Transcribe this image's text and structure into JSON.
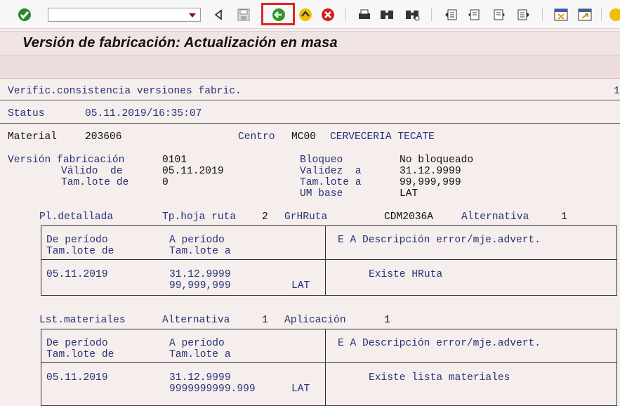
{
  "toolbar": {
    "command_value": "",
    "icons": [
      "enter-icon",
      "back-icon",
      "save-icon",
      "exit-icon",
      "home-icon",
      "cancel-icon",
      "print-icon",
      "find-icon",
      "find-next-icon",
      "first-page-icon",
      "prev-page-icon",
      "next-page-icon",
      "last-page-icon",
      "new-window-icon",
      "shortcut-icon"
    ]
  },
  "title": "Versión de fabricación: Actualización en masa",
  "report": {
    "heading": "Verific.consistencia versiones fabric.",
    "page_no": "1",
    "status_label": "Status",
    "status_value": "05.11.2019/16:35:07",
    "material_label": "Material",
    "material_value": "203606",
    "centro_label": "Centro",
    "centro_code": "MC00",
    "centro_name": "CERVECERIA TECATE",
    "version_label": "Versión fabricación",
    "version_value": "0101",
    "valido_de_label": "Válido  de",
    "valido_de_value": "05.11.2019",
    "tamlote_de_label": "Tam.lote de",
    "tamlote_de_value": "0",
    "bloqueo_label": "Bloqueo",
    "bloqueo_value": "No bloqueado",
    "validez_a_label": "Validez  a",
    "validez_a_value": "31.12.9999",
    "tamlote_a_label": "Tam.lote a",
    "tamlote_a_value": "99,999,999",
    "um_base_label": "UM base",
    "um_base_value": "LAT",
    "section1": {
      "pl_label": "Pl.detallada",
      "tp_label": "Tp.hoja ruta",
      "tp_value": "2",
      "gr_label": "GrHRuta",
      "gr_value": "CDM2036A",
      "alt_label": "Alternativa",
      "alt_value": "1",
      "col_de_periodo": "De período",
      "col_tamlote_de": "Tam.lote de",
      "col_a_periodo": "A período",
      "col_tamlote_a": "Tam.lote a",
      "col_ea_desc": "E A Descripción error/mje.advert.",
      "row_de": "05.11.2019",
      "row_a": "31.12.9999",
      "row_lote": "99,999,999",
      "row_um": "LAT",
      "row_msg": "Existe HRuta"
    },
    "section2": {
      "lst_label": "Lst.materiales",
      "alt_label": "Alternativa",
      "alt_value": "1",
      "apl_label": "Aplicación",
      "apl_value": "1",
      "col_de_periodo": "De período",
      "col_tamlote_de": "Tam.lote de",
      "col_a_periodo": "A período",
      "col_tamlote_a": "Tam.lote a",
      "col_ea_desc": "E A Descripción error/mje.advert.",
      "row_de": "05.11.2019",
      "row_a": "31.12.9999",
      "row_lote": "9999999999.999",
      "row_um": "LAT",
      "row_msg": "Existe lista materiales"
    }
  }
}
